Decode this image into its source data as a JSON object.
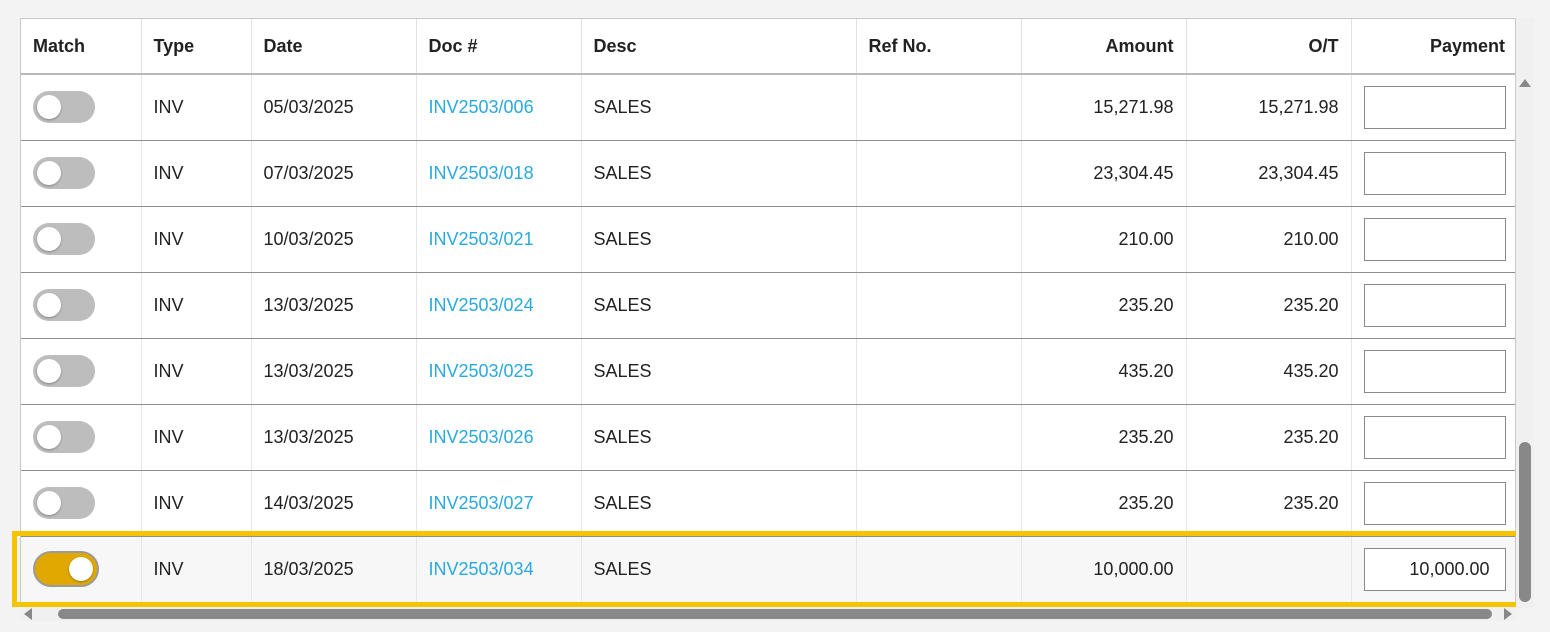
{
  "columns": {
    "match": "Match",
    "type": "Type",
    "date": "Date",
    "doc": "Doc #",
    "desc": "Desc",
    "ref": "Ref No.",
    "amount": "Amount",
    "ot": "O/T",
    "payment": "Payment"
  },
  "rows": [
    {
      "match": false,
      "type": "INV",
      "date": "05/03/2025",
      "doc": "INV2503/006",
      "desc": "SALES",
      "ref": "",
      "amount": "15,271.98",
      "ot": "15,271.98",
      "payment": ""
    },
    {
      "match": false,
      "type": "INV",
      "date": "07/03/2025",
      "doc": "INV2503/018",
      "desc": "SALES",
      "ref": "",
      "amount": "23,304.45",
      "ot": "23,304.45",
      "payment": ""
    },
    {
      "match": false,
      "type": "INV",
      "date": "10/03/2025",
      "doc": "INV2503/021",
      "desc": "SALES",
      "ref": "",
      "amount": "210.00",
      "ot": "210.00",
      "payment": ""
    },
    {
      "match": false,
      "type": "INV",
      "date": "13/03/2025",
      "doc": "INV2503/024",
      "desc": "SALES",
      "ref": "",
      "amount": "235.20",
      "ot": "235.20",
      "payment": ""
    },
    {
      "match": false,
      "type": "INV",
      "date": "13/03/2025",
      "doc": "INV2503/025",
      "desc": "SALES",
      "ref": "",
      "amount": "435.20",
      "ot": "435.20",
      "payment": ""
    },
    {
      "match": false,
      "type": "INV",
      "date": "13/03/2025",
      "doc": "INV2503/026",
      "desc": "SALES",
      "ref": "",
      "amount": "235.20",
      "ot": "235.20",
      "payment": ""
    },
    {
      "match": false,
      "type": "INV",
      "date": "14/03/2025",
      "doc": "INV2503/027",
      "desc": "SALES",
      "ref": "",
      "amount": "235.20",
      "ot": "235.20",
      "payment": ""
    },
    {
      "match": true,
      "type": "INV",
      "date": "18/03/2025",
      "doc": "INV2503/034",
      "desc": "SALES",
      "ref": "",
      "amount": "10,000.00",
      "ot": "",
      "payment": "10,000.00"
    }
  ],
  "colors": {
    "accent_link": "#29a9e0",
    "toggle_on": "#e0a800",
    "toggle_off": "#bdbdbd",
    "highlight": "#f5c400"
  },
  "icons": {
    "scroll_up": "scroll-up-arrow-icon",
    "scroll_down": "scroll-down-arrow-icon",
    "scroll_left": "scroll-left-arrow-icon",
    "scroll_right": "scroll-right-arrow-icon"
  }
}
